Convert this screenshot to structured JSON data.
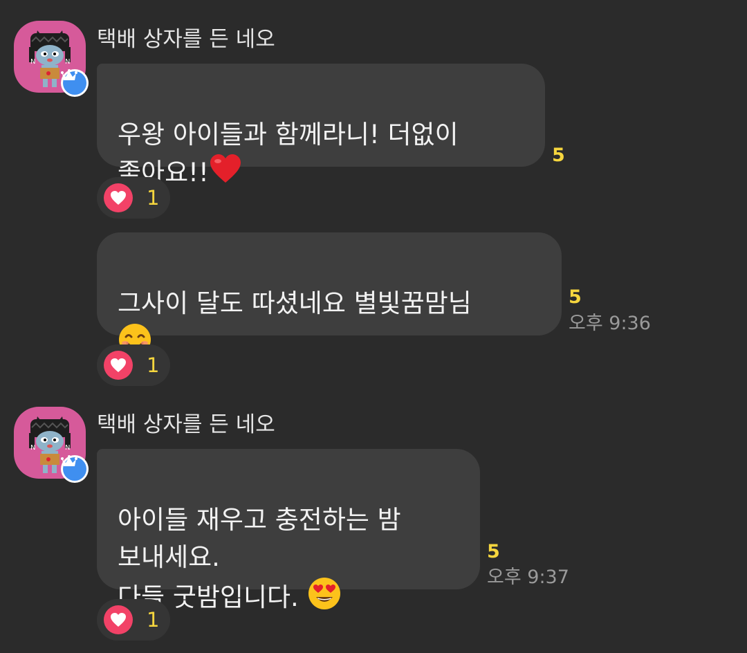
{
  "messages": [
    {
      "sender": "택배 상자를 든 네오",
      "text": "우왕 아이들과 함께라니! 더없이\n좋아요!!",
      "emoji": "❤️",
      "unread": "5",
      "time": "",
      "reaction_count": "1"
    },
    {
      "sender": "",
      "text": "그사이 달도 따셨네요 별빛꿈맘님\n",
      "emoji": "😊",
      "unread": "5",
      "time": "오후 9:36",
      "reaction_count": "1"
    },
    {
      "sender": "택배 상자를 든 네오",
      "text": "아이들 재우고 충전하는 밤\n보내세요.\n다들 굿밤입니다. ",
      "emoji": "😍",
      "unread": "5",
      "time": "오후 9:37",
      "reaction_count": "1"
    }
  ],
  "icons": {
    "avatar": "neo-character-avatar",
    "badge": "crown-icon",
    "reaction": "heart-icon"
  },
  "colors": {
    "background": "#2b2b2b",
    "bubble": "#3e3e3e",
    "unread": "#f6d63e",
    "avatar_bg": "#d65a9a",
    "badge": "#3f8ff0",
    "heart": "#f24267"
  }
}
